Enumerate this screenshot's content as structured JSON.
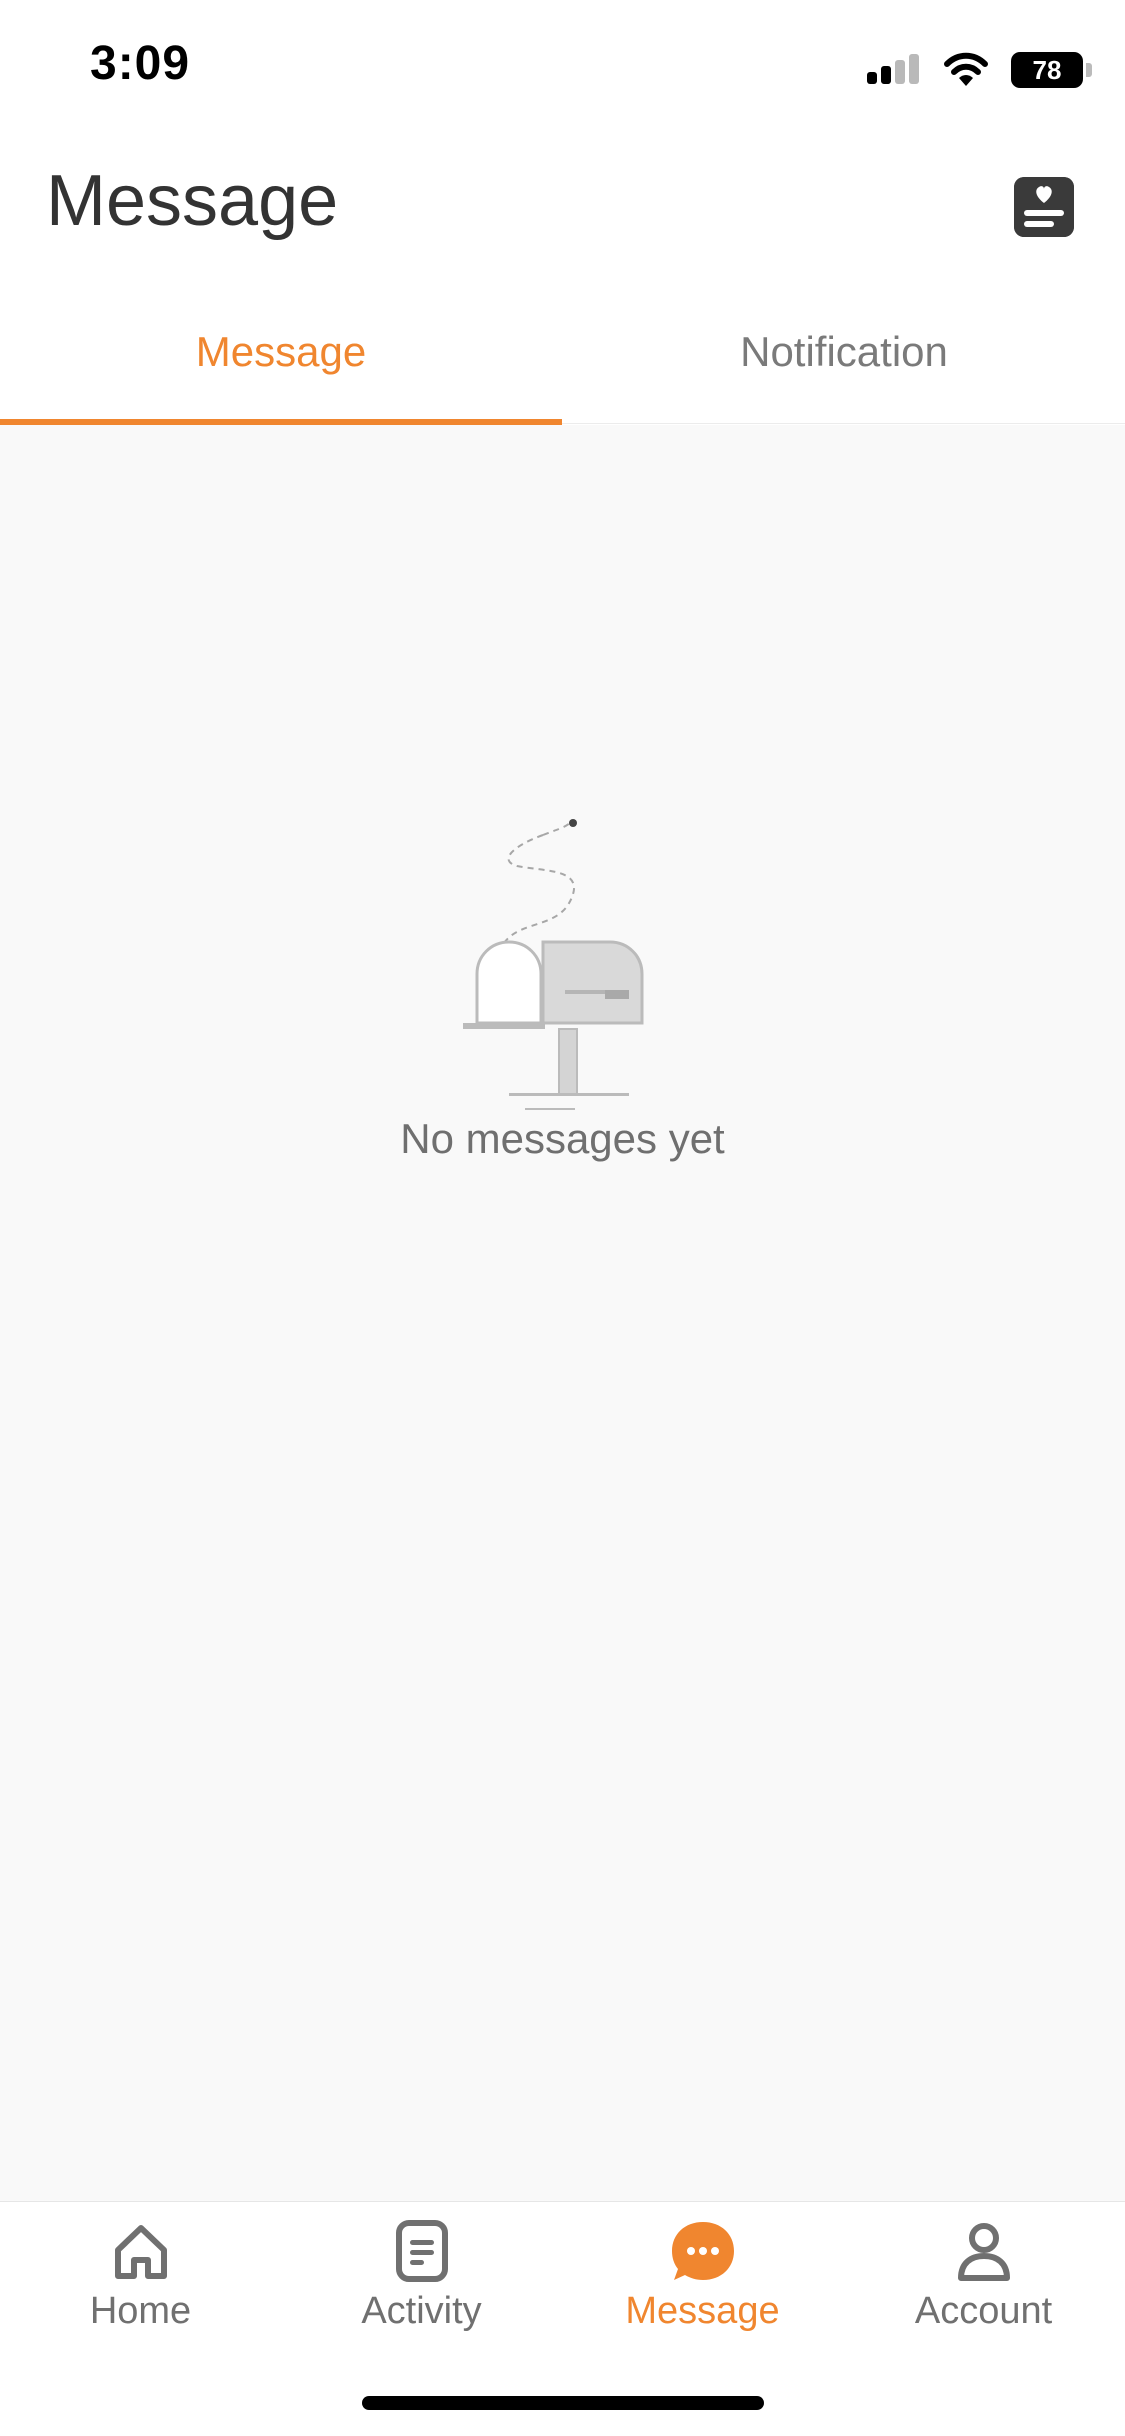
{
  "status_bar": {
    "time": "3:09",
    "battery": "78"
  },
  "header": {
    "title": "Message",
    "icon": "heart-list-icon"
  },
  "tabs": [
    {
      "label": "Message",
      "active": true
    },
    {
      "label": "Notification",
      "active": false
    }
  ],
  "empty_state": {
    "text": "No messages yet",
    "icon": "mailbox-icon"
  },
  "bottom_nav": [
    {
      "label": "Home",
      "icon": "home-icon",
      "active": false
    },
    {
      "label": "Activity",
      "icon": "activity-icon",
      "active": false
    },
    {
      "label": "Message",
      "icon": "message-icon",
      "active": true
    },
    {
      "label": "Account",
      "icon": "account-icon",
      "active": false
    }
  ],
  "colors": {
    "accent": "#f0862f",
    "text_primary": "#333333",
    "text_secondary": "#707070",
    "content_background": "#f9f9f9"
  }
}
